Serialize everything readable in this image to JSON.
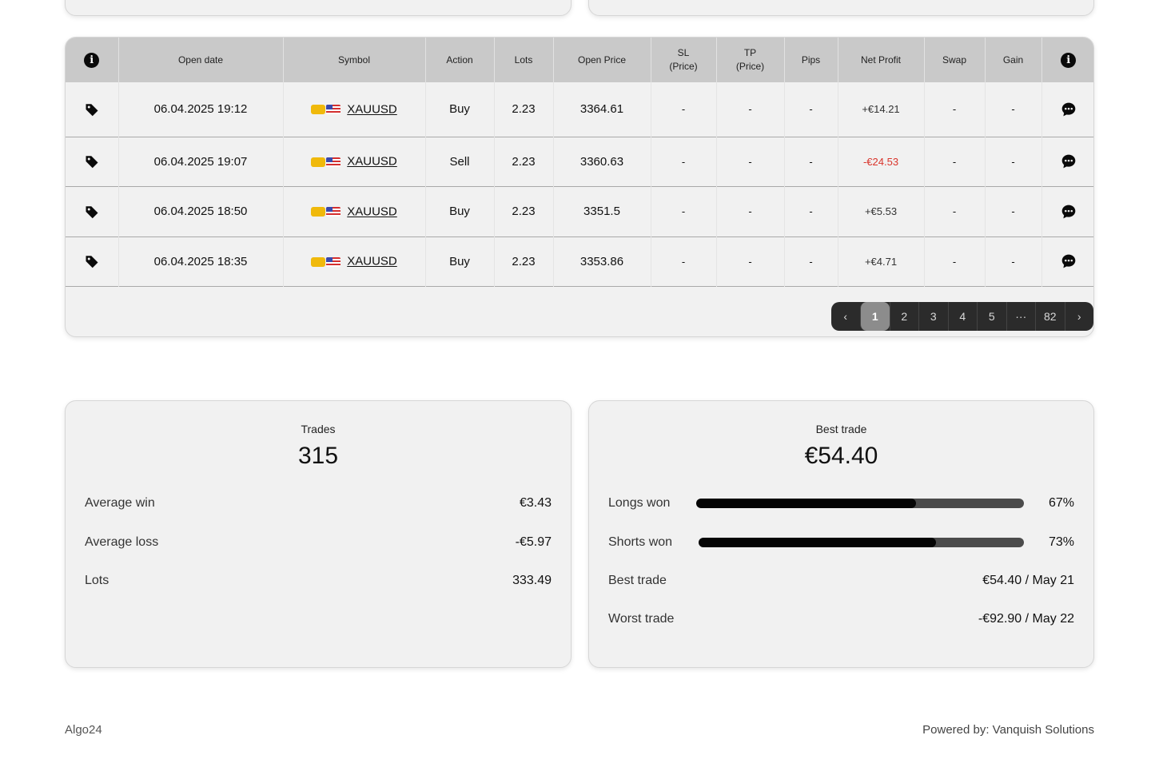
{
  "table": {
    "headers": {
      "open_date": "Open date",
      "symbol": "Symbol",
      "action": "Action",
      "lots": "Lots",
      "open_price": "Open Price",
      "sl_line1": "SL",
      "sl_line2": "(Price)",
      "tp_line1": "TP",
      "tp_line2": "(Price)",
      "pips": "Pips",
      "net_profit": "Net Profit",
      "swap": "Swap",
      "gain": "Gain"
    },
    "info_glyph": "i",
    "rows": [
      {
        "date": "06.04.2025 19:12",
        "symbol": "XAUUSD",
        "action": "Buy",
        "lots": "2.23",
        "open_price": "3364.61",
        "sl": "-",
        "tp": "-",
        "pips": "-",
        "net_profit": "+€14.21",
        "swap": "-",
        "gain": "-"
      },
      {
        "date": "06.04.2025 19:07",
        "symbol": "XAUUSD",
        "action": "Sell",
        "lots": "2.23",
        "open_price": "3360.63",
        "sl": "-",
        "tp": "-",
        "pips": "-",
        "net_profit": "-€24.53",
        "swap": "-",
        "gain": "-"
      },
      {
        "date": "06.04.2025 18:50",
        "symbol": "XAUUSD",
        "action": "Buy",
        "lots": "2.23",
        "open_price": "3351.5",
        "sl": "-",
        "tp": "-",
        "pips": "-",
        "net_profit": "+€5.53",
        "swap": "-",
        "gain": "-"
      },
      {
        "date": "06.04.2025 18:35",
        "symbol": "XAUUSD",
        "action": "Buy",
        "lots": "2.23",
        "open_price": "3353.86",
        "sl": "-",
        "tp": "-",
        "pips": "-",
        "net_profit": "+€4.71",
        "swap": "-",
        "gain": "-"
      }
    ],
    "colors": {
      "profit_positive": "#333333",
      "profit_negative": "#d9342b"
    }
  },
  "pagination": {
    "prev": "‹",
    "pages": [
      "1",
      "2",
      "3",
      "4",
      "5",
      "···",
      "82"
    ],
    "next": "›",
    "active_page": "1"
  },
  "stats_left": {
    "title": "Trades",
    "value": "315",
    "rows": [
      {
        "label": "Average win",
        "value": "€3.43"
      },
      {
        "label": "Average loss",
        "value": "-€5.97"
      },
      {
        "label": "Lots",
        "value": "333.49"
      }
    ]
  },
  "stats_right": {
    "title": "Best trade",
    "value": "€54.40",
    "longs": {
      "label": "Longs won",
      "percent_text": "67%",
      "fraction": 0.67
    },
    "shorts": {
      "label": "Shorts won",
      "percent_text": "73%",
      "fraction": 0.73
    },
    "best": {
      "label": "Best trade",
      "value": "€54.40 / May 21"
    },
    "worst": {
      "label": "Worst trade",
      "value": "-€92.90 / May 22"
    }
  },
  "footer": {
    "left": "Algo24",
    "right": "Powered by: Vanquish Solutions"
  }
}
